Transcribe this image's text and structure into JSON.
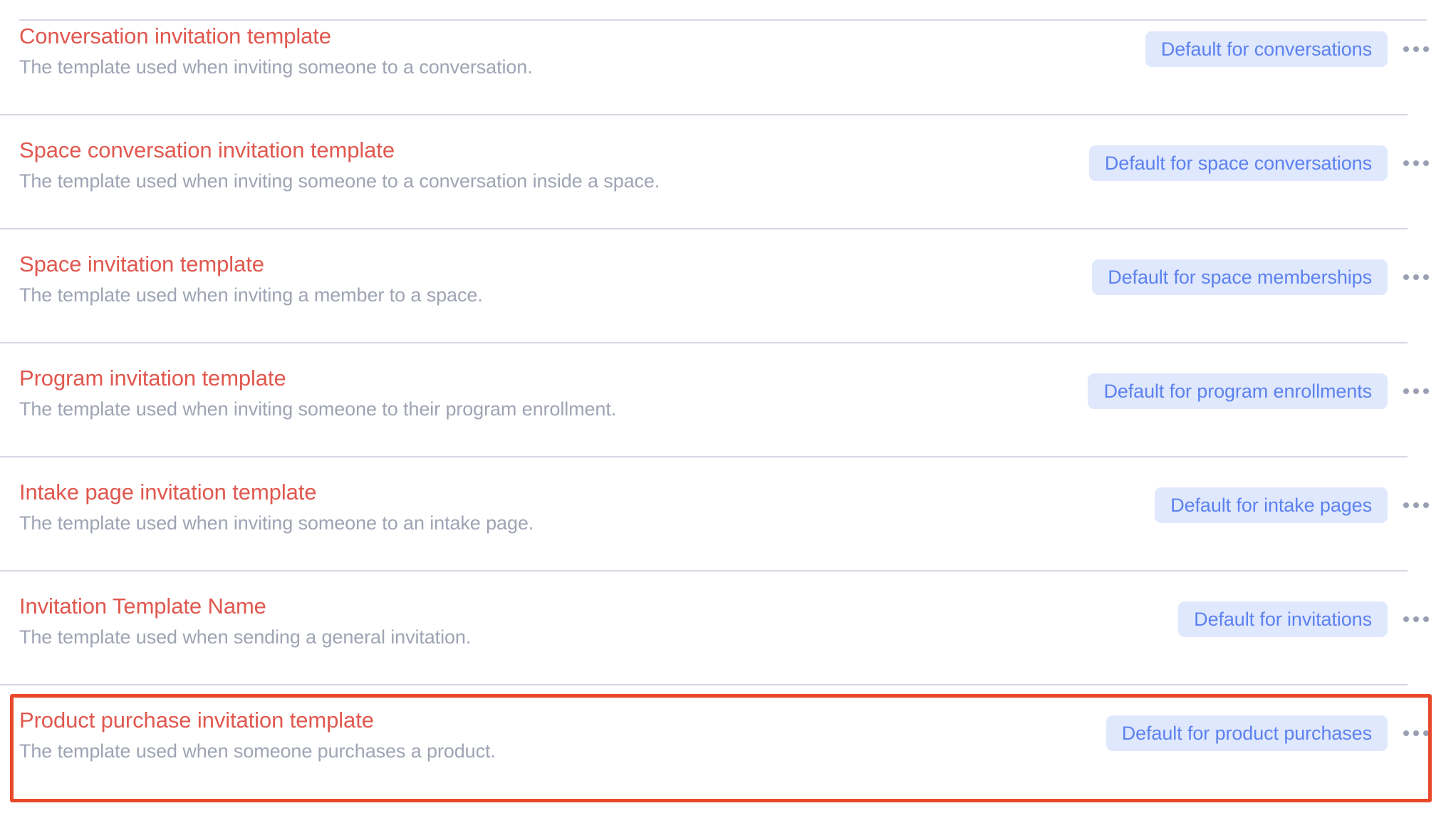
{
  "theme": {
    "title_color": "#e0584f",
    "description_color": "#9fa4b4",
    "badge_background": "#e0e8fd",
    "badge_text_color": "#5c82ef",
    "divider_color": "#d6d7e3",
    "highlight_border_color": "#e8492a",
    "kebab_dot_color": "#9aa0b2",
    "page_background": "#ffffff"
  },
  "list": {
    "rows": [
      {
        "title": "Conversation invitation template",
        "description": "The template used when inviting someone to a conversation.",
        "badge": "Default for conversations",
        "menu_icon": "ellipsis-icon",
        "highlighted": false
      },
      {
        "title": "Space conversation invitation template",
        "description": "The template used when inviting someone to a conversation inside a space.",
        "badge": "Default for space conversations",
        "menu_icon": "ellipsis-icon",
        "highlighted": false
      },
      {
        "title": "Space invitation template",
        "description": "The template used when inviting a member to a space.",
        "badge": "Default for space memberships",
        "menu_icon": "ellipsis-icon",
        "highlighted": false
      },
      {
        "title": "Program invitation template",
        "description": "The template used when inviting someone to their program enrollment.",
        "badge": "Default for program enrollments",
        "menu_icon": "ellipsis-icon",
        "highlighted": false
      },
      {
        "title": "Intake page invitation template",
        "description": "The template used when inviting someone to an intake page.",
        "badge": "Default for intake pages",
        "menu_icon": "ellipsis-icon",
        "highlighted": false
      },
      {
        "title": "Invitation Template Name",
        "description": "The template used when sending a general invitation.",
        "badge": "Default for invitations",
        "menu_icon": "ellipsis-icon",
        "highlighted": false
      },
      {
        "title": "Product purchase invitation template",
        "description": "The template used when someone purchases a product.",
        "badge": "Default for product purchases",
        "menu_icon": "ellipsis-icon",
        "highlighted": true
      }
    ]
  }
}
